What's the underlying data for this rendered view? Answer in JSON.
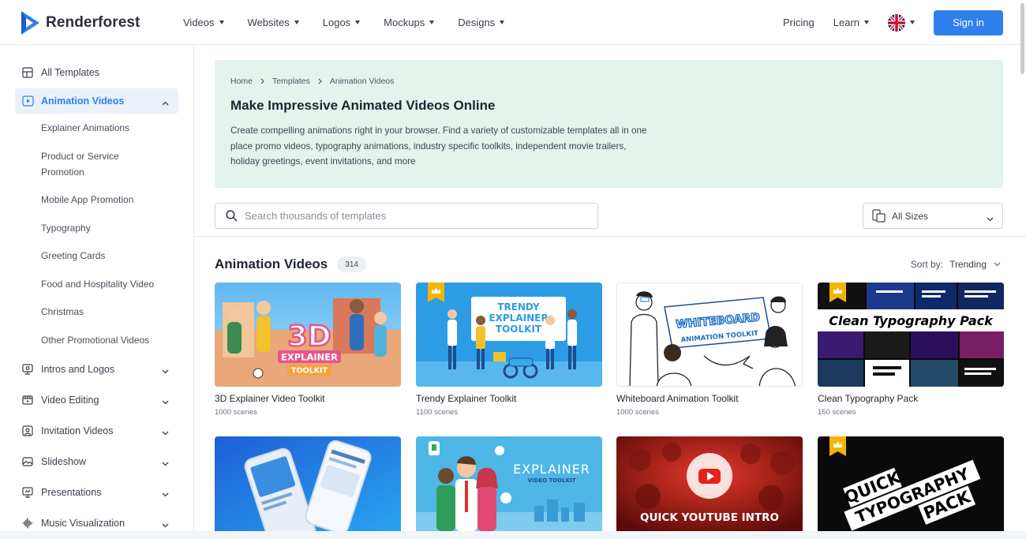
{
  "brand": {
    "name": "Renderforest",
    "accent": "#2f80ed",
    "banner_bg": "#e4f3ec"
  },
  "nav": {
    "menu": [
      "Videos",
      "Websites",
      "Logos",
      "Mockups",
      "Designs"
    ],
    "pricing": "Pricing",
    "learn": "Learn",
    "language_icon": "uk-flag-icon",
    "signin": "Sign in"
  },
  "sidebar": {
    "all_templates": "All Templates",
    "animation_videos": "Animation Videos",
    "sub_items": [
      "Explainer Animations",
      "Product or Service Promotion",
      "Mobile App Promotion",
      "Typography",
      "Greeting Cards",
      "Food and Hospitality Video",
      "Christmas",
      "Other Promotional Videos"
    ],
    "categories": [
      "Intros and Logos",
      "Video Editing",
      "Invitation Videos",
      "Slideshow",
      "Presentations",
      "Music Visualization"
    ]
  },
  "breadcrumb": [
    "Home",
    "Templates",
    "Animation Videos"
  ],
  "hero": {
    "title": "Make Impressive Animated Videos Online",
    "description": "Create compelling animations right in your browser. Find a variety of customizable templates all in one place promo videos, typography animations, industry specific toolkits, independent movie trailers, holiday greetings, event invitations, and more"
  },
  "search": {
    "placeholder": "Search thousands of templates"
  },
  "sizes": {
    "label": "All Sizes"
  },
  "section": {
    "title": "Animation Videos",
    "count": "314"
  },
  "sort": {
    "label": "Sort by:",
    "value": "Trending"
  },
  "cards": [
    {
      "title": "3D Explainer Video Toolkit",
      "scenes": "1000 scenes",
      "thumb_text": [
        "3D",
        "EXPLAINER",
        "TOOLKIT"
      ]
    },
    {
      "title": "Trendy Explainer Toolkit",
      "scenes": "1100 scenes",
      "thumb_text": [
        "TRENDY",
        "EXPLAINER",
        "TOOLKIT"
      ]
    },
    {
      "title": "Whiteboard Animation Toolkit",
      "scenes": "1000 scenes",
      "thumb_text": [
        "WHITEBOARD",
        "ANIMATION TOOLKIT"
      ]
    },
    {
      "title": "Clean Typography Pack",
      "scenes": "150 scenes",
      "thumb_text": [
        "Clean Typography Pack"
      ]
    },
    {
      "title": "",
      "scenes": "",
      "thumb_text": []
    },
    {
      "title": "",
      "scenes": "",
      "thumb_text": [
        "EXPLAINER",
        "VIDEO TOOLKIT"
      ]
    },
    {
      "title": "",
      "scenes": "",
      "thumb_text": [
        "QUICK YOUTUBE INTRO"
      ]
    },
    {
      "title": "",
      "scenes": "",
      "thumb_text": [
        "QUICK",
        "TYPOGRAPHY",
        "PACK"
      ]
    }
  ]
}
